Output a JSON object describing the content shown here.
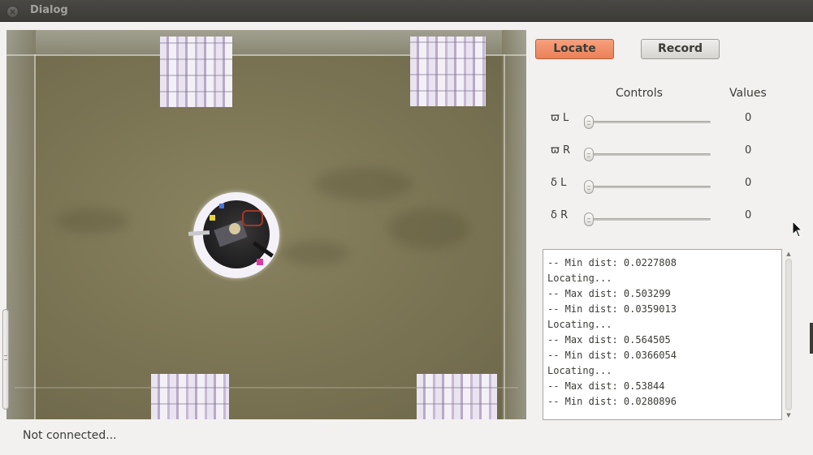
{
  "window": {
    "title": "Dialog"
  },
  "toolbar": {
    "locate_label": "Locate",
    "record_label": "Record"
  },
  "controls": {
    "header_controls": "Controls",
    "header_values": "Values",
    "items": [
      {
        "label": "ϖ L",
        "value": "0",
        "slider_level": 0
      },
      {
        "label": "ϖ R",
        "value": "0",
        "slider_level": 0
      },
      {
        "label": "δ L",
        "value": "0",
        "slider_level": 0
      },
      {
        "label": "δ R",
        "value": "0",
        "slider_level": 0
      }
    ]
  },
  "log": {
    "lines": [
      "-- Min dist: 0.0227808",
      "Locating...",
      "-- Max dist: 0.503299",
      "-- Min dist: 0.0359013",
      "Locating...",
      "-- Max dist: 0.564505",
      "-- Min dist: 0.0366054",
      "Locating...",
      "-- Max dist: 0.53844",
      "-- Min dist: 0.0280896"
    ]
  },
  "status": {
    "text": "Not connected..."
  },
  "colors": {
    "locate_button": "#ea8156",
    "titlebar": "#3c3b37",
    "background": "#f2f1f0"
  },
  "icons": {
    "close": "close-icon",
    "scroll_up": "chevron-up-icon",
    "scroll_down": "chevron-down-icon",
    "cursor": "mouse-pointer-icon"
  }
}
